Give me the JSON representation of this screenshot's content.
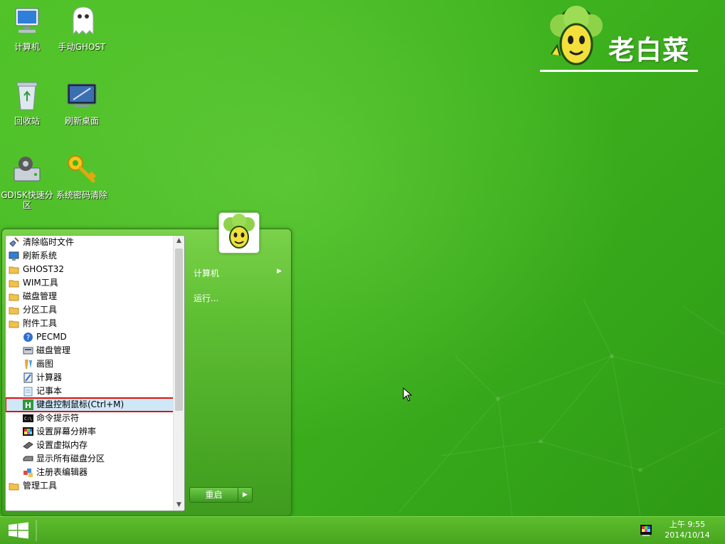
{
  "brand": {
    "text": "老白菜"
  },
  "desktop_icons": [
    {
      "label": "计算机"
    },
    {
      "label": "手动GHOST"
    },
    {
      "label": "回收站"
    },
    {
      "label": "刷新桌面"
    },
    {
      "label": "GDISK快速分区"
    },
    {
      "label": "系统密码清除"
    }
  ],
  "start_menu": {
    "items": [
      {
        "label": "清除临时文件",
        "icon": "broom-icon",
        "level": 0
      },
      {
        "label": "刷新系统",
        "icon": "monitor-icon",
        "level": 0
      },
      {
        "label": "GHOST32",
        "icon": "folder-icon",
        "level": 0
      },
      {
        "label": "WIM工具",
        "icon": "folder-icon",
        "level": 0
      },
      {
        "label": "磁盘管理",
        "icon": "folder-icon",
        "level": 0
      },
      {
        "label": "分区工具",
        "icon": "folder-icon",
        "level": 0
      },
      {
        "label": "附件工具",
        "icon": "folder-icon",
        "level": 0
      },
      {
        "label": "PECMD",
        "icon": "help-icon",
        "level": 1
      },
      {
        "label": "磁盘管理",
        "icon": "disk-manager-icon",
        "level": 1
      },
      {
        "label": "画图",
        "icon": "paint-icon",
        "level": 1
      },
      {
        "label": "计算器",
        "icon": "calculator-icon",
        "level": 1
      },
      {
        "label": "记事本",
        "icon": "notepad-icon",
        "level": 1
      },
      {
        "label": "键盘控制鼠标(Ctrl+M)",
        "icon": "keyboard-mouse-icon",
        "level": 1,
        "selected": true
      },
      {
        "label": "命令提示符",
        "icon": "cmd-icon",
        "level": 1
      },
      {
        "label": "设置屏幕分辨率",
        "icon": "display-settings-icon",
        "level": 1
      },
      {
        "label": "设置虚拟内存",
        "icon": "memory-icon",
        "level": 1
      },
      {
        "label": "显示所有磁盘分区",
        "icon": "drive-icon",
        "level": 1
      },
      {
        "label": "注册表编辑器",
        "icon": "registry-icon",
        "level": 1
      },
      {
        "label": "管理工具",
        "icon": "folder-icon",
        "level": 0
      }
    ],
    "right": {
      "computer": "计算机",
      "run": "运行..."
    },
    "restart": "重启"
  },
  "taskbar": {
    "time": "上午 9:55",
    "date": "2014/10/14"
  },
  "colors": {
    "desktop_green": "#3fb31f",
    "selection_border": "#e01010"
  }
}
